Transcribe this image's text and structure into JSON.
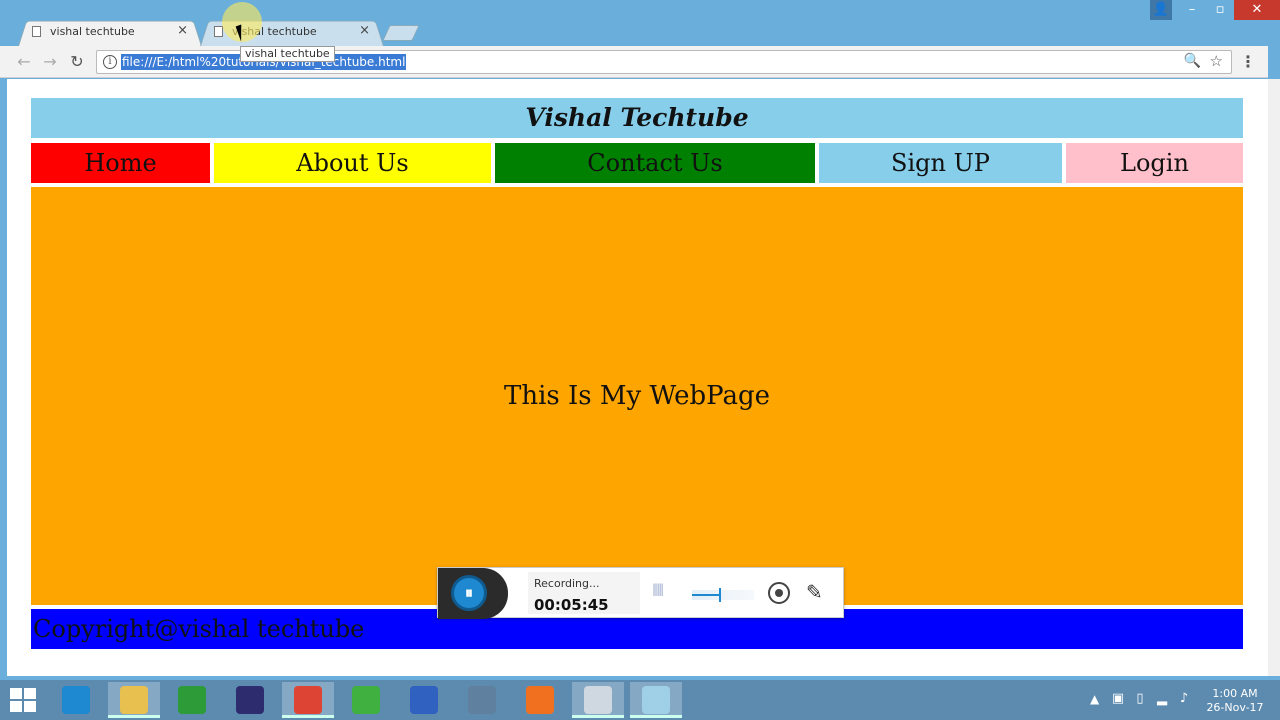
{
  "browser": {
    "tabs": [
      {
        "title": "vishal techtube",
        "active": true
      },
      {
        "title": "vishal techtube",
        "active": false
      }
    ],
    "tooltip": "vishal techtube",
    "url": "file:///E:/html%20tutorials/vishal_techtube.html",
    "icons": {
      "back": "←",
      "forward": "→",
      "reload": "↻",
      "info": "i",
      "zoom": "🔍",
      "star": "☆",
      "menu": "⋮",
      "close_tab": "×",
      "minimize": "–",
      "maximize": "▫",
      "close_window": "✕",
      "user": "👤"
    }
  },
  "page": {
    "header_title": "Vishal Techtube",
    "nav": [
      {
        "label": "Home",
        "color": "#ff0000"
      },
      {
        "label": "About Us",
        "color": "#ffff00"
      },
      {
        "label": "Contact Us",
        "color": "#008000"
      },
      {
        "label": "Sign UP",
        "color": "#87ceeb"
      },
      {
        "label": "Login",
        "color": "#ffc0cb"
      }
    ],
    "main_text": "This Is My WebPage",
    "footer_text": "Copyright@vishal techtube",
    "colors": {
      "header": "#87ceeb",
      "main": "#ffa500",
      "footer": "#0000ff"
    }
  },
  "recorder": {
    "status": "Recording...",
    "time": "00:05:45",
    "volume_level": 0.45,
    "icons": {
      "pause": "⏸",
      "pen": "✎"
    }
  },
  "taskbar": {
    "apps": [
      {
        "name": "internet-explorer",
        "color": "#1e88d0",
        "active": false
      },
      {
        "name": "file-explorer",
        "color": "#e8c050",
        "active": true
      },
      {
        "name": "store",
        "color": "#2d9b38",
        "active": false
      },
      {
        "name": "eclipse",
        "color": "#2c2c6e",
        "active": false
      },
      {
        "name": "chrome",
        "color": "#dd4433",
        "active": true
      },
      {
        "name": "dreamweaver",
        "color": "#40b040",
        "active": false
      },
      {
        "name": "network-app",
        "color": "#3060c0",
        "active": false
      },
      {
        "name": "media-app",
        "color": "#6080a0",
        "active": false
      },
      {
        "name": "firefox",
        "color": "#f07020",
        "active": false
      },
      {
        "name": "notepad",
        "color": "#cfd8e0",
        "active": true
      },
      {
        "name": "paint",
        "color": "#a0d0e8",
        "active": true
      }
    ],
    "clock_time": "1:00 AM",
    "clock_date": "26-Nov-17"
  }
}
